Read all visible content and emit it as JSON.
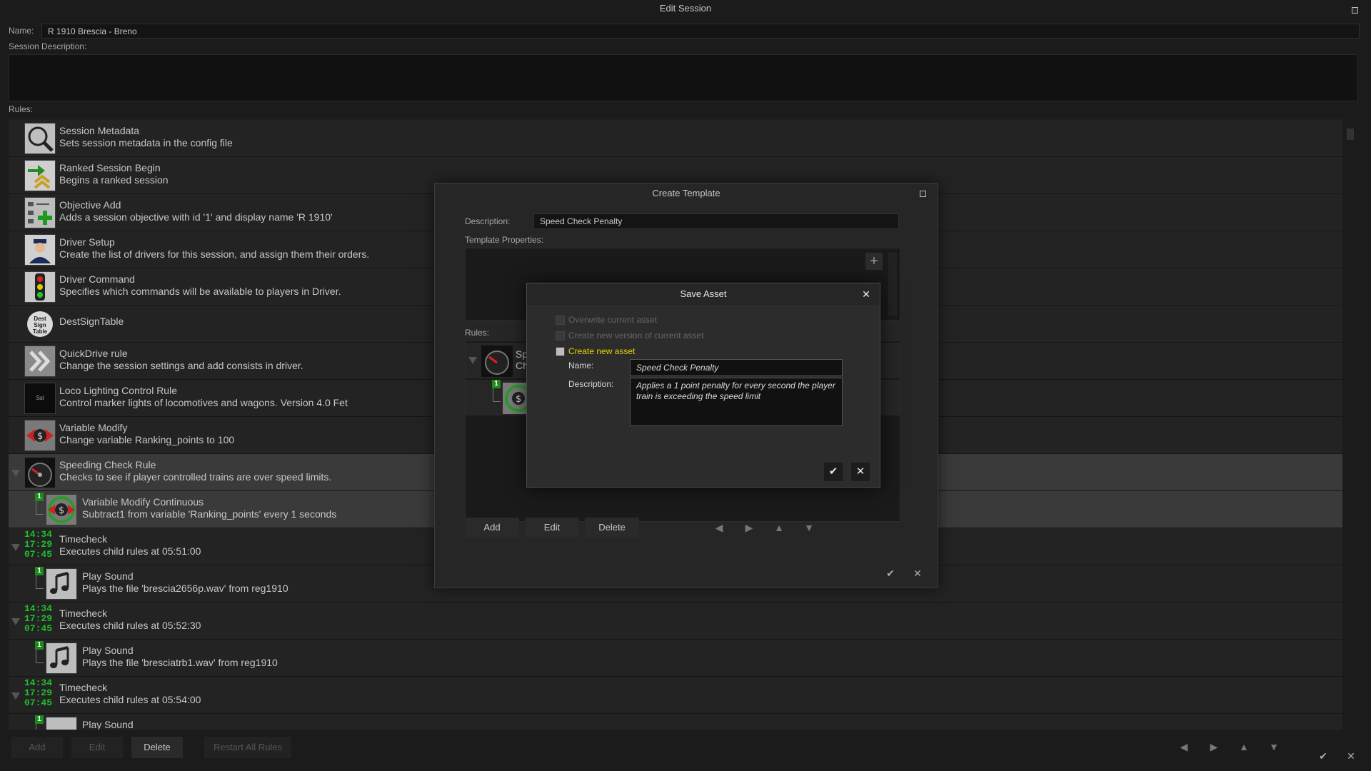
{
  "window": {
    "title": "Edit Session"
  },
  "session": {
    "name_label": "Name:",
    "name_value": "R 1910 Brescia - Breno",
    "desc_label": "Session Description:",
    "rules_label": "Rules:"
  },
  "rules": [
    {
      "title": "Session Metadata",
      "sub": "Sets session metadata in the config file",
      "icon": "magnifier-icon"
    },
    {
      "title": "Ranked Session Begin",
      "sub": "Begins a ranked session",
      "icon": "ranked-chevron-icon"
    },
    {
      "title": "Objective Add",
      "sub": "Adds a session objective with id '1' and display name 'R 1910'",
      "icon": "objective-add-icon"
    },
    {
      "title": "Driver Setup",
      "sub": "Create the list of drivers for this session, and assign them their orders.",
      "icon": "driver-icon"
    },
    {
      "title": "Driver Command",
      "sub": "Specifies which commands will be available to players in Driver.",
      "icon": "traffic-light-icon"
    },
    {
      "title": "DestSignTable",
      "sub": "",
      "icon": "dest-sign-icon",
      "icon_text": "Dest Sign Table"
    },
    {
      "title": "QuickDrive rule",
      "sub": "Change the session settings and add consists in driver.",
      "icon": "quickdrive-icon"
    },
    {
      "title": "Loco Lighting Control Rule",
      "sub": "Control marker lights of locomotives and wagons. Version 4.0 Fet",
      "icon": "loco-lighting-icon",
      "icon_text": "Ssl"
    },
    {
      "title": "Variable Modify",
      "sub": "Change variable Ranking_points to 100",
      "icon": "variable-modify-icon"
    },
    {
      "title": "Speeding Check Rule",
      "sub": "Checks to see if player controlled trains are over speed limits.",
      "icon": "speedometer-icon"
    },
    {
      "title": "Variable Modify Continuous",
      "sub": "Subtract1 from variable 'Ranking_points' every 1 seconds",
      "icon": "variable-modify-continuous-icon",
      "badge": "1"
    },
    {
      "title": "Timecheck",
      "sub": "Executes child rules at 05:51:00",
      "icon": "clock-icon"
    },
    {
      "title": "Play Sound",
      "sub": "Plays the file 'brescia2656p.wav' from reg1910",
      "icon": "sound-icon",
      "badge": "1"
    },
    {
      "title": "Timecheck",
      "sub": "Executes child rules at 05:52:30",
      "icon": "clock-icon"
    },
    {
      "title": "Play Sound",
      "sub": "Plays the file 'bresciatrb1.wav' from reg1910",
      "icon": "sound-icon",
      "badge": "1"
    },
    {
      "title": "Timecheck",
      "sub": "Executes child rules at 05:54:00",
      "icon": "clock-icon"
    },
    {
      "title": "Play Sound",
      "sub": "",
      "icon": "sound-icon",
      "badge": "1"
    }
  ],
  "clock_lines": [
    "14:34",
    "17:29",
    "07:45"
  ],
  "bottom_buttons": {
    "add": "Add",
    "edit": "Edit",
    "delete": "Delete",
    "restart": "Restart All Rules"
  },
  "create_template": {
    "title": "Create Template",
    "desc_label": "Description:",
    "desc_value": "Speed Check Penalty",
    "props_label": "Template Properties:",
    "rules_label": "Rules:",
    "rule_title_trunc": "Sp",
    "rule_sub_trunc": "Ch",
    "add": "Add",
    "edit": "Edit",
    "delete": "Delete"
  },
  "save_asset": {
    "title": "Save Asset",
    "opt_overwrite": "Overwrite current asset",
    "opt_new_version": "Create new version of current asset",
    "opt_new_asset": "Create new asset",
    "name_label": "Name:",
    "name_value": "Speed Check Penalty",
    "desc_label": "Description:",
    "desc_value": "Applies a 1 point penalty for every second the player train is exceeding the speed limit"
  },
  "colors": {
    "accent_yellow": "#e8d400",
    "clock_green": "#1fbf2a",
    "badge_green": "#1d8a1d"
  }
}
